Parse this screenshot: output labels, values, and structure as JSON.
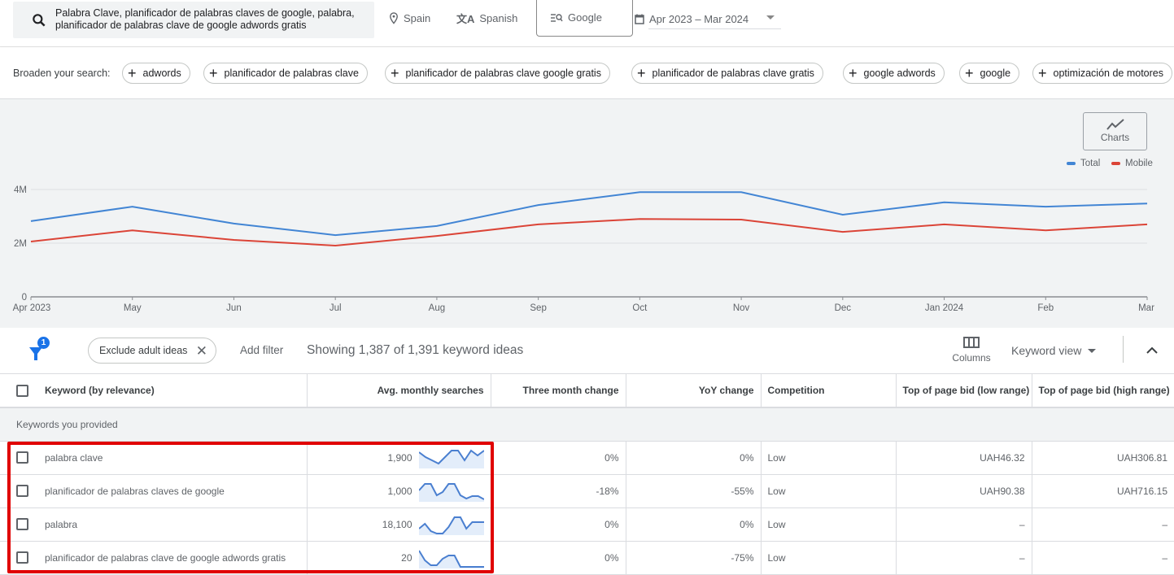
{
  "toolbar": {
    "search_query": "Palabra Clave, planificador de palabras claves de google, palabra, planificador de palabras clave de google adwords gratis",
    "location": "Spain",
    "language": "Spanish",
    "network": "Google",
    "date_range": "Apr 2023 – Mar 2024",
    "icons": {
      "search": "search-icon",
      "location": "location-pin-icon",
      "language": "translate-icon",
      "network": "search-network-icon",
      "date": "calendar-icon"
    }
  },
  "broaden": {
    "label": "Broaden your search:",
    "chips": [
      "adwords",
      "planificador de palabras clave",
      "planificador de palabras clave google gratis",
      "planificador de palabras clave gratis",
      "google adwords",
      "google",
      "optimización de motores"
    ]
  },
  "charts_button": "Charts",
  "colors": {
    "total": "#4285d4",
    "mobile": "#db4437",
    "accent": "#1a73e8",
    "highlight": "#e00000"
  },
  "chart_data": {
    "type": "line",
    "title": "",
    "xlabel": "",
    "ylabel": "",
    "categories": [
      "Apr 2023",
      "May",
      "Jun",
      "Jul",
      "Aug",
      "Sep",
      "Oct",
      "Nov",
      "Dec",
      "Jan 2024",
      "Feb",
      "Mar"
    ],
    "y_ticks": [
      "0",
      "2M",
      "4M"
    ],
    "y_tick_values": [
      0,
      2000000,
      4000000
    ],
    "ylim": [
      0,
      4000000
    ],
    "grid": true,
    "legend_position": "top-right",
    "series": [
      {
        "name": "Total",
        "color": "#4285d4",
        "values": [
          2820000,
          3360000,
          2730000,
          2300000,
          2640000,
          3420000,
          3900000,
          3900000,
          3060000,
          3520000,
          3360000,
          3480000
        ]
      },
      {
        "name": "Mobile",
        "color": "#db4437",
        "values": [
          2060000,
          2480000,
          2120000,
          1910000,
          2270000,
          2700000,
          2900000,
          2880000,
          2420000,
          2700000,
          2480000,
          2700000
        ]
      }
    ]
  },
  "filterbar": {
    "filter_count": "1",
    "exclude_chip": "Exclude adult ideas",
    "add_filter": "Add filter",
    "showing": "Showing 1,387 of 1,391 keyword ideas",
    "columns": "Columns",
    "keyword_view": "Keyword view"
  },
  "table": {
    "headers": [
      "Keyword (by relevance)",
      "Avg. monthly searches",
      "Three month change",
      "YoY change",
      "Competition",
      "Top of page bid (low range)",
      "Top of page bid (high range)"
    ],
    "group_label": "Keywords you provided",
    "rows": [
      {
        "keyword": "palabra clave",
        "avg": "1,900",
        "trend": [
          0.9,
          0.6,
          0.4,
          0.2,
          0.6,
          1.0,
          1.0,
          0.4,
          1.0,
          0.7,
          1.0
        ],
        "three_month": "0%",
        "yoy": "0%",
        "competition": "Low",
        "low_bid": "UAH46.32",
        "high_bid": "UAH306.81"
      },
      {
        "keyword": "planificador de palabras claves de google",
        "avg": "1,000",
        "trend": [
          0.6,
          1.0,
          1.0,
          0.3,
          0.5,
          1.0,
          1.0,
          0.3,
          0.1,
          0.25,
          0.25,
          0.05
        ],
        "three_month": "-18%",
        "yoy": "-55%",
        "competition": "Low",
        "low_bid": "UAH90.38",
        "high_bid": "UAH716.15"
      },
      {
        "keyword": "palabra",
        "avg": "18,100",
        "trend": [
          0.3,
          0.6,
          0.15,
          0.0,
          0.0,
          0.4,
          1.0,
          1.0,
          0.3,
          0.7,
          0.7,
          0.7
        ],
        "three_month": "0%",
        "yoy": "0%",
        "competition": "Low",
        "low_bid": "–",
        "high_bid": "–"
      },
      {
        "keyword": "planificador de palabras clave de google adwords gratis",
        "avg": "20",
        "trend": [
          1.0,
          0.4,
          0.1,
          0.1,
          0.5,
          0.7,
          0.7,
          0.0,
          0.0,
          0.0,
          0.0,
          0.0
        ],
        "three_month": "0%",
        "yoy": "-75%",
        "competition": "Low",
        "low_bid": "–",
        "high_bid": "–"
      }
    ]
  }
}
